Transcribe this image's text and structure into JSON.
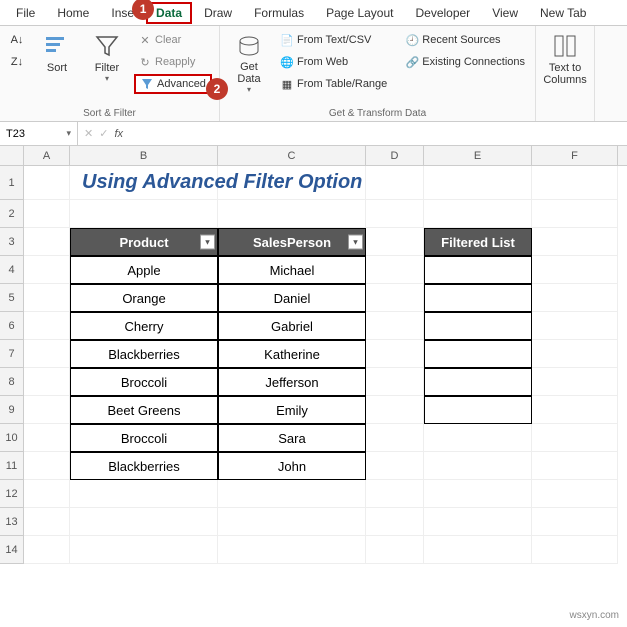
{
  "tabs": [
    "File",
    "Home",
    "Inse",
    "Data",
    "Draw",
    "Formulas",
    "Page Layout",
    "Developer",
    "View",
    "New Tab"
  ],
  "active_tab_index": 3,
  "badges": {
    "tab_data": "1",
    "advanced": "2"
  },
  "ribbon": {
    "sort_group": {
      "label": "Sort & Filter",
      "sort": "Sort",
      "filter": "Filter",
      "clear": "Clear",
      "reapply": "Reapply",
      "advanced": "Advanced"
    },
    "get_group": {
      "label": "Get & Transform Data",
      "get_data": "Get Data",
      "from_text": "From Text/CSV",
      "from_web": "From Web",
      "from_table": "From Table/Range",
      "recent": "Recent Sources",
      "existing": "Existing Connections"
    },
    "text_to_columns": "Text to Columns"
  },
  "namebox": "T23",
  "columns": [
    "A",
    "B",
    "C",
    "D",
    "E",
    "F"
  ],
  "row_numbers": [
    "1",
    "2",
    "3",
    "4",
    "5",
    "6",
    "7",
    "8",
    "9",
    "10",
    "11",
    "12",
    "13",
    "14"
  ],
  "title": "Using Advanced Filter Option",
  "table": {
    "headers": {
      "product": "Product",
      "sales": "SalesPerson"
    },
    "rows": [
      {
        "product": "Apple",
        "sales": "Michael"
      },
      {
        "product": "Orange",
        "sales": "Daniel"
      },
      {
        "product": "Cherry",
        "sales": "Gabriel"
      },
      {
        "product": "Blackberries",
        "sales": "Katherine"
      },
      {
        "product": "Broccoli",
        "sales": "Jefferson"
      },
      {
        "product": "Beet Greens",
        "sales": "Emily"
      },
      {
        "product": "Broccoli",
        "sales": "Sara"
      },
      {
        "product": "Blackberries",
        "sales": "John"
      }
    ]
  },
  "filtered_header": "Filtered List",
  "watermark": "wsxyn.com"
}
